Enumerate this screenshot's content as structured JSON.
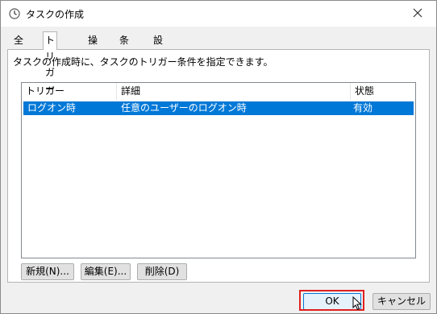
{
  "window": {
    "title": "タスクの作成"
  },
  "tabs": [
    {
      "label": "全般"
    },
    {
      "label": "トリガー"
    },
    {
      "label": "操作"
    },
    {
      "label": "条件"
    },
    {
      "label": "設定"
    }
  ],
  "panel": {
    "description": "タスクの作成時に、タスクのトリガー条件を指定できます。"
  },
  "list": {
    "columns": [
      "トリガー",
      "詳細",
      "状態"
    ],
    "rows": [
      {
        "trigger": "ログオン時",
        "detail": "任意のユーザーのログオン時",
        "status": "有効",
        "selected": true
      }
    ]
  },
  "buttons": {
    "new": "新規(N)...",
    "edit": "編集(E)...",
    "delete": "削除(D)",
    "ok": "OK",
    "cancel": "キャンセル"
  },
  "colors": {
    "selection": "#0078d7",
    "highlight_box": "#e02020"
  }
}
